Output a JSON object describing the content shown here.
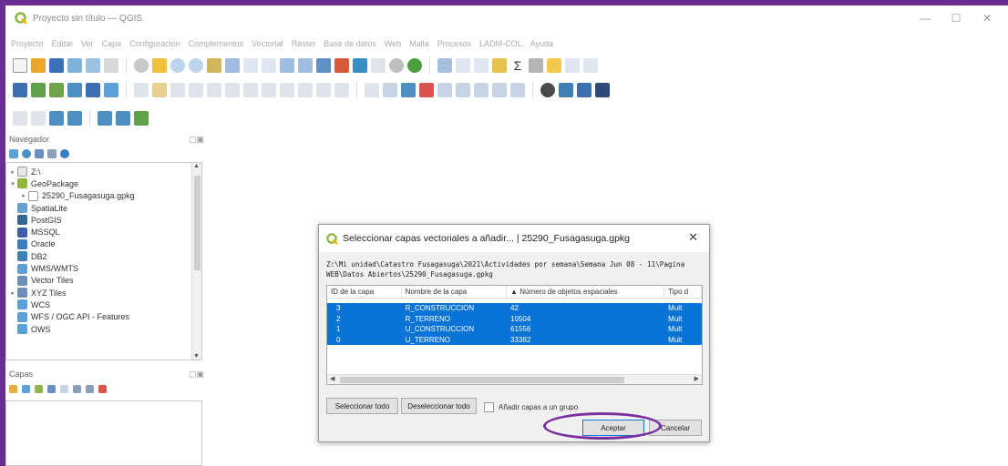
{
  "window": {
    "title": "Proyecto sin título — QGIS",
    "controls": [
      "—",
      "☐",
      "✕"
    ]
  },
  "menubar": [
    "Proyecto",
    "Editar",
    "Ver",
    "Capa",
    "Configuración",
    "Complementos",
    "Vectorial",
    "Ráster",
    "Base de datos",
    "Web",
    "Malla",
    "Procesos",
    "LADM-COL",
    "Ayuda"
  ],
  "browser": {
    "title": "Navegador",
    "items": [
      {
        "label": "Z:\\",
        "icon": "folder-icon",
        "arrow": "▸",
        "indent": 0
      },
      {
        "label": "GeoPackage",
        "icon": "geopackage-icon",
        "arrow": "▾",
        "indent": 0
      },
      {
        "label": "25290_Fusagasuga.gpkg",
        "icon": "table-icon",
        "arrow": "▸",
        "indent": 1
      },
      {
        "label": "SpatiaLite",
        "icon": "spatialite-icon",
        "arrow": "",
        "indent": 0
      },
      {
        "label": "PostGIS",
        "icon": "postgis-icon",
        "arrow": "",
        "indent": 0
      },
      {
        "label": "MSSQL",
        "icon": "mssql-icon",
        "arrow": "",
        "indent": 0
      },
      {
        "label": "Oracle",
        "icon": "oracle-icon",
        "arrow": "",
        "indent": 0
      },
      {
        "label": "DB2",
        "icon": "db2-icon",
        "arrow": "",
        "indent": 0
      },
      {
        "label": "WMS/WMTS",
        "icon": "wms-icon",
        "arrow": "",
        "indent": 0
      },
      {
        "label": "Vector Tiles",
        "icon": "grid-icon",
        "arrow": "",
        "indent": 0
      },
      {
        "label": "XYZ Tiles",
        "icon": "grid-icon",
        "arrow": "▸",
        "indent": 0
      },
      {
        "label": "WCS",
        "icon": "wcs-icon",
        "arrow": "",
        "indent": 0
      },
      {
        "label": "WFS / OGC API - Features",
        "icon": "wfs-icon",
        "arrow": "",
        "indent": 0
      },
      {
        "label": "OWS",
        "icon": "ows-icon",
        "arrow": "",
        "indent": 0
      }
    ]
  },
  "layers": {
    "title": "Capas"
  },
  "dialog": {
    "title": "Seleccionar capas vectoriales a añadir... | 25290_Fusagasuga.gpkg",
    "close": "✕",
    "path": "Z:\\Mi unidad\\Catastro Fusagasuga\\2021\\Actividades por semana\\Semana Jun 08 - 11\\Pagina WEB\\Datos Abiertos\\25290_Fusagasuga.gpkg",
    "columns": [
      "ID de la capa",
      "Nombre de la capa",
      "▲ Número de objetos espaciales",
      "Tipo d"
    ],
    "rows": [
      {
        "id": "3",
        "name": "R_CONSTRUCCION",
        "count": "42",
        "type": "Mult"
      },
      {
        "id": "2",
        "name": "R_TERRENO",
        "count": "10504",
        "type": "Mult"
      },
      {
        "id": "1",
        "name": "U_CONSTRUCCION",
        "count": "61556",
        "type": "Mult"
      },
      {
        "id": "0",
        "name": "U_TERRENO",
        "count": "33382",
        "type": "Mult"
      }
    ],
    "select_all": "Seleccionar todo",
    "deselect_all": "Deseleccionar todo",
    "add_to_group": "Añadir capas a un grupo",
    "accept": "Aceptar",
    "cancel": "Cancelar"
  },
  "colors": {
    "frame": "#6a2c91",
    "selection": "#0a74d6",
    "highlight": "#7b2fa0"
  }
}
